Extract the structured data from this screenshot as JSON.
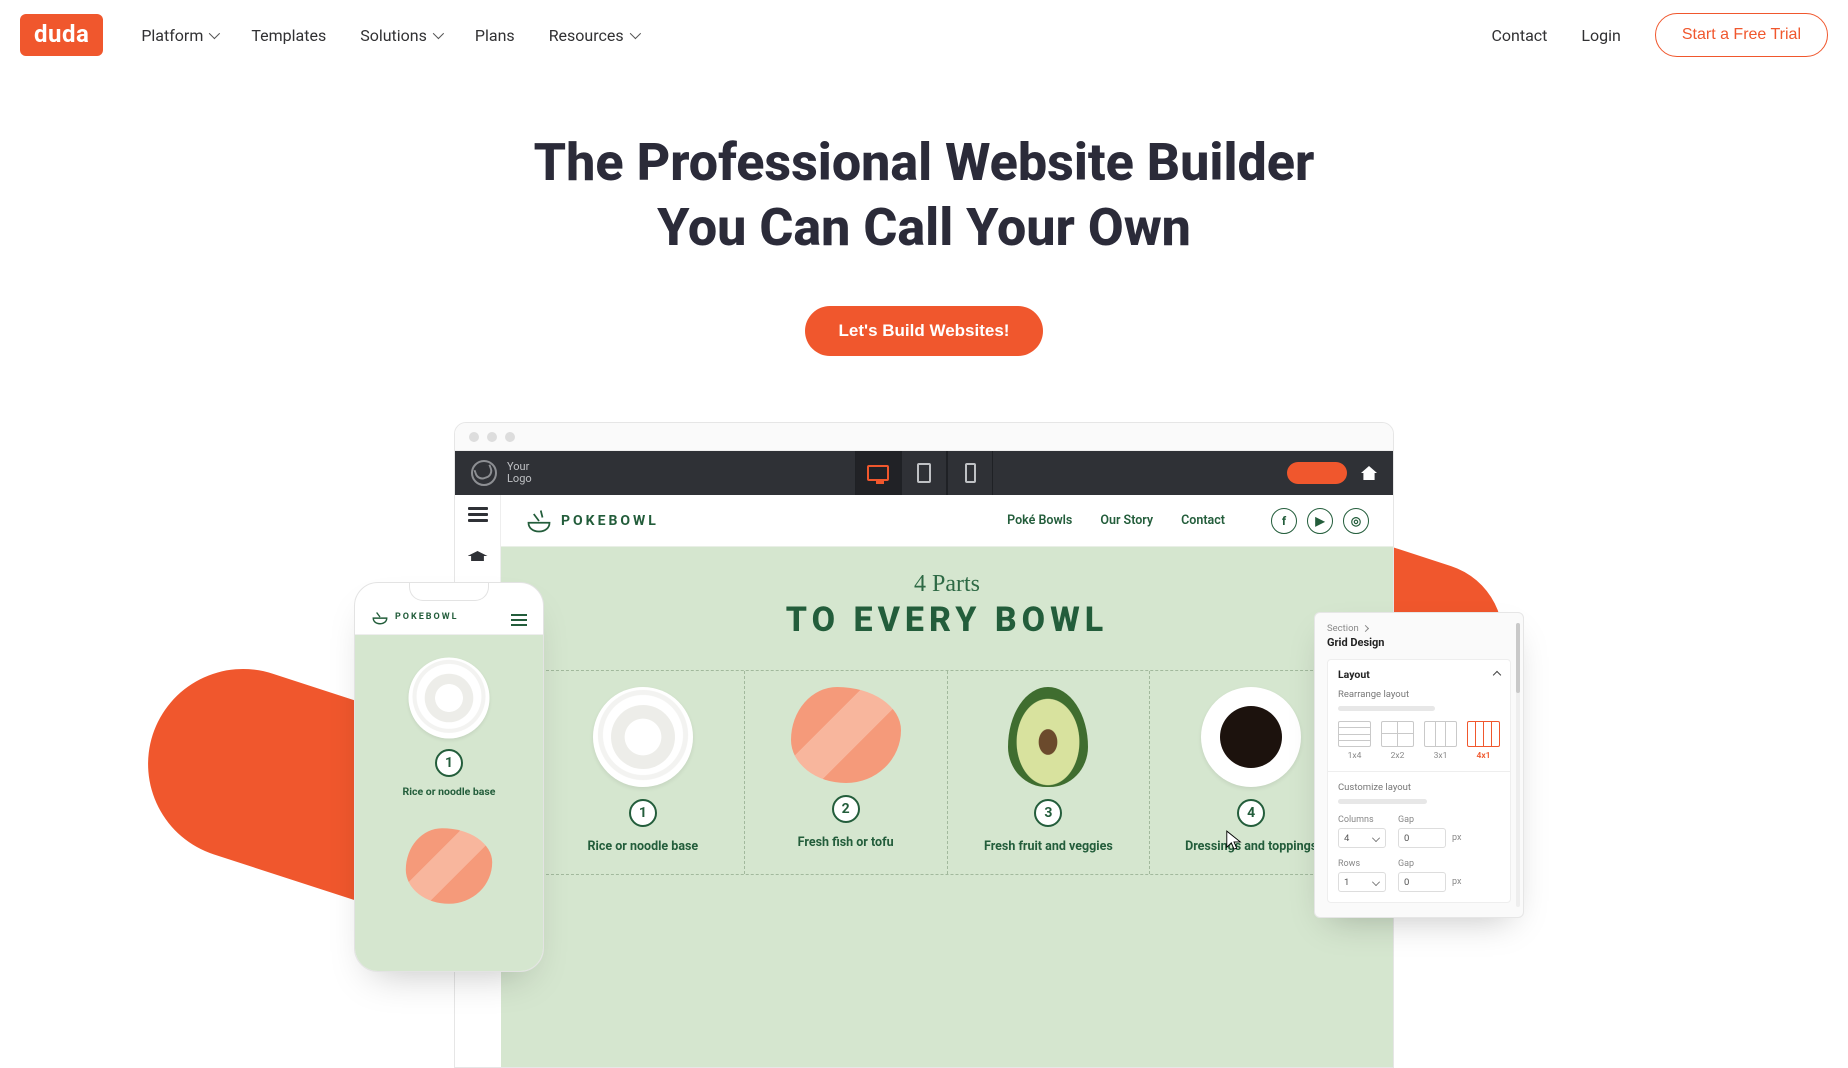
{
  "nav": {
    "logo": "duda",
    "items": [
      {
        "label": "Platform",
        "dropdown": true
      },
      {
        "label": "Templates",
        "dropdown": false
      },
      {
        "label": "Solutions",
        "dropdown": true
      },
      {
        "label": "Plans",
        "dropdown": false
      },
      {
        "label": "Resources",
        "dropdown": true
      }
    ],
    "right": {
      "contact": "Contact",
      "login": "Login",
      "cta": "Start a Free Trial"
    }
  },
  "hero": {
    "line1": "The Professional Website Builder",
    "line2": "You Can Call Your Own",
    "cta": "Let's Build Websites!"
  },
  "editor": {
    "your_logo": "Your\nLogo",
    "site": {
      "brand": "POKEBOWL",
      "nav": [
        "Poké Bowls",
        "Our Story",
        "Contact"
      ],
      "section_script": "4 Parts",
      "section_block": "TO EVERY BOWL",
      "cards": [
        {
          "num": "1",
          "label": "Rice or noodle base"
        },
        {
          "num": "2",
          "label": "Fresh fish or tofu"
        },
        {
          "num": "3",
          "label": "Fresh fruit and veggies"
        },
        {
          "num": "4",
          "label": "Dressings and toppings"
        }
      ]
    }
  },
  "phone": {
    "brand": "POKEBOWL",
    "card1_num": "1",
    "card1_label": "Rice or noodle base"
  },
  "panel": {
    "crumb": "Section",
    "title": "Grid Design",
    "section_label": "Layout",
    "rearrange": "Rearrange layout",
    "layout_labels": [
      "1x4",
      "2x2",
      "3x1",
      "4x1"
    ],
    "customize": "Customize layout",
    "columns_label": "Columns",
    "gap_label": "Gap",
    "rows_label": "Rows",
    "col_value": "4",
    "row_value": "1",
    "gap_value": "0",
    "unit": "px"
  }
}
